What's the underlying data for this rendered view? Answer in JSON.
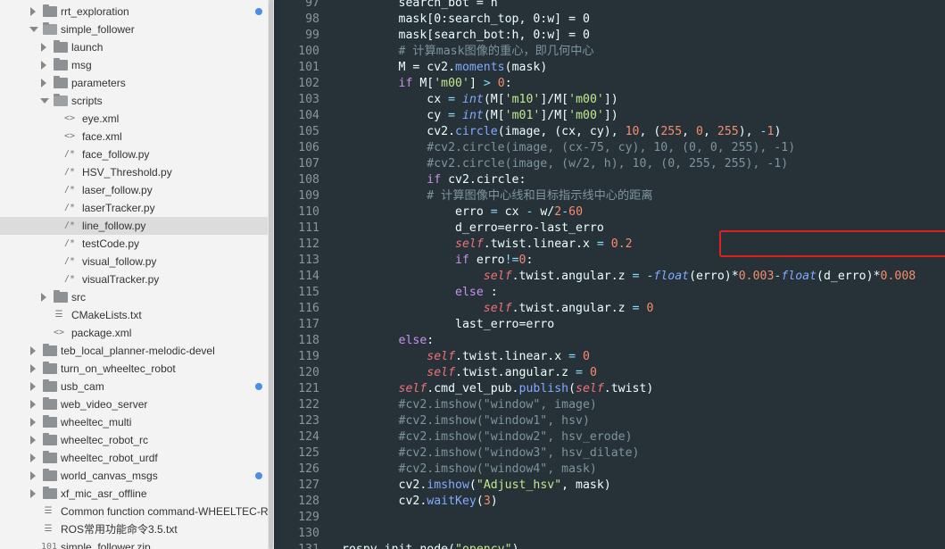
{
  "sidebar": {
    "items": [
      {
        "label": "rrt_exploration",
        "type": "folder",
        "level": 0,
        "expanded": false,
        "dot": true
      },
      {
        "label": "simple_follower",
        "type": "folder",
        "level": 0,
        "expanded": true,
        "dot": false
      },
      {
        "label": "launch",
        "type": "folder",
        "level": 1,
        "expanded": false,
        "dot": false
      },
      {
        "label": "msg",
        "type": "folder",
        "level": 1,
        "expanded": false,
        "dot": false
      },
      {
        "label": "parameters",
        "type": "folder",
        "level": 1,
        "expanded": false,
        "dot": false
      },
      {
        "label": "scripts",
        "type": "folder",
        "level": 1,
        "expanded": true,
        "dot": false
      },
      {
        "label": "eye.xml",
        "type": "file",
        "icon": "<>",
        "level": 2
      },
      {
        "label": "face.xml",
        "type": "file",
        "icon": "<>",
        "level": 2
      },
      {
        "label": "face_follow.py",
        "type": "file",
        "icon": "/*",
        "level": 2
      },
      {
        "label": "HSV_Threshold.py",
        "type": "file",
        "icon": "/*",
        "level": 2
      },
      {
        "label": "laser_follow.py",
        "type": "file",
        "icon": "/*",
        "level": 2
      },
      {
        "label": "laserTracker.py",
        "type": "file",
        "icon": "/*",
        "level": 2
      },
      {
        "label": "line_follow.py",
        "type": "file",
        "icon": "/*",
        "level": 2,
        "selected": true
      },
      {
        "label": "testCode.py",
        "type": "file",
        "icon": "/*",
        "level": 2
      },
      {
        "label": "visual_follow.py",
        "type": "file",
        "icon": "/*",
        "level": 2
      },
      {
        "label": "visualTracker.py",
        "type": "file",
        "icon": "/*",
        "level": 2
      },
      {
        "label": "src",
        "type": "folder",
        "level": 1,
        "expanded": false,
        "dot": false
      },
      {
        "label": "CMakeLists.txt",
        "type": "file",
        "icon": "☰",
        "level": 1
      },
      {
        "label": "package.xml",
        "type": "file",
        "icon": "<>",
        "level": 1
      },
      {
        "label": "teb_local_planner-melodic-devel",
        "type": "folder",
        "level": 0,
        "expanded": false,
        "dot": false
      },
      {
        "label": "turn_on_wheeltec_robot",
        "type": "folder",
        "level": 0,
        "expanded": false,
        "dot": false
      },
      {
        "label": "usb_cam",
        "type": "folder",
        "level": 0,
        "expanded": false,
        "dot": true
      },
      {
        "label": "web_video_server",
        "type": "folder",
        "level": 0,
        "expanded": false,
        "dot": false
      },
      {
        "label": "wheeltec_multi",
        "type": "folder",
        "level": 0,
        "expanded": false,
        "dot": false
      },
      {
        "label": "wheeltec_robot_rc",
        "type": "folder",
        "level": 0,
        "expanded": false,
        "dot": false
      },
      {
        "label": "wheeltec_robot_urdf",
        "type": "folder",
        "level": 0,
        "expanded": false,
        "dot": false
      },
      {
        "label": "world_canvas_msgs",
        "type": "folder",
        "level": 0,
        "expanded": false,
        "dot": true
      },
      {
        "label": "xf_mic_asr_offline",
        "type": "folder",
        "level": 0,
        "expanded": false,
        "dot": false
      },
      {
        "label": "Common function command-WHEELTEC-RC",
        "type": "file",
        "icon": "☰",
        "level": 0
      },
      {
        "label": "ROS常用功能命令3.5.txt",
        "type": "file",
        "icon": "☰",
        "level": 0
      },
      {
        "label": "simple_follower.zip",
        "type": "file",
        "icon": "101",
        "level": 0
      }
    ]
  },
  "editor": {
    "file": "line_follow.py",
    "lines": [
      {
        "n": "97",
        "t": [
          [
            "id",
            "        search_bot = h"
          ]
        ]
      },
      {
        "n": "98",
        "t": [
          [
            "id",
            "        mask[0:search_top, 0:w] = 0"
          ]
        ]
      },
      {
        "n": "99",
        "t": [
          [
            "id",
            "        mask[search_bot:h, 0:w] = 0"
          ]
        ]
      },
      {
        "n": "100",
        "t": [
          [
            "cm",
            "        # 计算mask图像的重心，即几何中心"
          ]
        ]
      },
      {
        "n": "101",
        "t": [
          [
            "id",
            "        M = cv2."
          ],
          [
            "fn",
            "moments"
          ],
          [
            "id",
            "(mask)"
          ]
        ]
      },
      {
        "n": "102",
        "t": [
          [
            "kw",
            "        if "
          ],
          [
            "id",
            "M["
          ],
          [
            "str",
            "'m00'"
          ],
          [
            "id",
            "] "
          ],
          [
            "op",
            ">"
          ],
          [
            "id",
            " "
          ],
          [
            "num",
            "0"
          ],
          [
            "id",
            ":"
          ]
        ]
      },
      {
        "n": "103",
        "t": [
          [
            "id",
            "            cx "
          ],
          [
            "op",
            "="
          ],
          [
            "id",
            " "
          ],
          [
            "bi",
            "int"
          ],
          [
            "id",
            "(M["
          ],
          [
            "str",
            "'m10'"
          ],
          [
            "id",
            "]/M["
          ],
          [
            "str",
            "'m00'"
          ],
          [
            "id",
            "])"
          ]
        ]
      },
      {
        "n": "104",
        "t": [
          [
            "id",
            "            cy "
          ],
          [
            "op",
            "="
          ],
          [
            "id",
            " "
          ],
          [
            "bi",
            "int"
          ],
          [
            "id",
            "(M["
          ],
          [
            "str",
            "'m01'"
          ],
          [
            "id",
            "]/M["
          ],
          [
            "str",
            "'m00'"
          ],
          [
            "id",
            "])"
          ]
        ]
      },
      {
        "n": "105",
        "t": [
          [
            "id",
            "            cv2."
          ],
          [
            "fn",
            "circle"
          ],
          [
            "id",
            "(image, (cx, cy), "
          ],
          [
            "num",
            "10"
          ],
          [
            "id",
            ", ("
          ],
          [
            "num",
            "255"
          ],
          [
            "id",
            ", "
          ],
          [
            "num",
            "0"
          ],
          [
            "id",
            ", "
          ],
          [
            "num",
            "255"
          ],
          [
            "id",
            "), "
          ],
          [
            "op",
            "-"
          ],
          [
            "num",
            "1"
          ],
          [
            "id",
            ")"
          ]
        ]
      },
      {
        "n": "106",
        "t": [
          [
            "cm",
            "            #cv2.circle(image, (cx-75, cy), 10, (0, 0, 255), -1)"
          ]
        ]
      },
      {
        "n": "107",
        "t": [
          [
            "cm",
            "            #cv2.circle(image, (w/2, h), 10, (0, 255, 255), -1)"
          ]
        ]
      },
      {
        "n": "108",
        "t": [
          [
            "kw",
            "            if "
          ],
          [
            "id",
            "cv2.circle:"
          ]
        ]
      },
      {
        "n": "109",
        "t": [
          [
            "cm",
            "            # 计算图像中心线和目标指示线中心的距离"
          ]
        ]
      },
      {
        "n": "110",
        "t": [
          [
            "id",
            "                erro "
          ],
          [
            "op",
            "="
          ],
          [
            "id",
            " cx "
          ],
          [
            "op",
            "-"
          ],
          [
            "id",
            " w/"
          ],
          [
            "num",
            "2"
          ],
          [
            "op",
            "-"
          ],
          [
            "num",
            "60"
          ]
        ]
      },
      {
        "n": "111",
        "t": [
          [
            "id",
            "                d_erro=erro-last_erro"
          ]
        ]
      },
      {
        "n": "112",
        "t": [
          [
            "self",
            "                self"
          ],
          [
            "id",
            ".twist.linear.x "
          ],
          [
            "op",
            "="
          ],
          [
            "id",
            " "
          ],
          [
            "num",
            "0.2"
          ]
        ]
      },
      {
        "n": "113",
        "t": [
          [
            "kw",
            "                if "
          ],
          [
            "id",
            "erro"
          ],
          [
            "op",
            "!="
          ],
          [
            "num",
            "0"
          ],
          [
            "id",
            ":"
          ]
        ]
      },
      {
        "n": "114",
        "t": [
          [
            "self",
            "                    self"
          ],
          [
            "id",
            ".twist.angular.z "
          ],
          [
            "op",
            "="
          ],
          [
            "id",
            " "
          ],
          [
            "op",
            "-"
          ],
          [
            "bi",
            "float"
          ],
          [
            "id",
            "(erro)*"
          ],
          [
            "num",
            "0.003"
          ],
          [
            "op",
            "-"
          ],
          [
            "bi",
            "float"
          ],
          [
            "id",
            "(d_erro)*"
          ],
          [
            "num",
            "0.008"
          ]
        ]
      },
      {
        "n": "115",
        "t": [
          [
            "kw",
            "                else "
          ],
          [
            "id",
            ":"
          ]
        ]
      },
      {
        "n": "116",
        "t": [
          [
            "self",
            "                    self"
          ],
          [
            "id",
            ".twist.angular.z "
          ],
          [
            "op",
            "="
          ],
          [
            "id",
            " "
          ],
          [
            "num",
            "0"
          ]
        ]
      },
      {
        "n": "117",
        "t": [
          [
            "id",
            "                last_erro=erro"
          ]
        ]
      },
      {
        "n": "118",
        "t": [
          [
            "kw",
            "        else"
          ],
          [
            "id",
            ":"
          ]
        ]
      },
      {
        "n": "119",
        "t": [
          [
            "self",
            "            self"
          ],
          [
            "id",
            ".twist.linear.x "
          ],
          [
            "op",
            "="
          ],
          [
            "id",
            " "
          ],
          [
            "num",
            "0"
          ]
        ]
      },
      {
        "n": "120",
        "t": [
          [
            "self",
            "            self"
          ],
          [
            "id",
            ".twist.angular.z "
          ],
          [
            "op",
            "="
          ],
          [
            "id",
            " "
          ],
          [
            "num",
            "0"
          ]
        ]
      },
      {
        "n": "121",
        "t": [
          [
            "self",
            "        self"
          ],
          [
            "id",
            ".cmd_vel_pub."
          ],
          [
            "fn",
            "publish"
          ],
          [
            "id",
            "("
          ],
          [
            "self",
            "self"
          ],
          [
            "id",
            ".twist)"
          ]
        ]
      },
      {
        "n": "122",
        "t": [
          [
            "cm",
            "        #cv2.imshow(\"window\", image)"
          ]
        ]
      },
      {
        "n": "123",
        "t": [
          [
            "cm",
            "        #cv2.imshow(\"window1\", hsv)"
          ]
        ]
      },
      {
        "n": "124",
        "t": [
          [
            "cm",
            "        #cv2.imshow(\"window2\", hsv_erode)"
          ]
        ]
      },
      {
        "n": "125",
        "t": [
          [
            "cm",
            "        #cv2.imshow(\"window3\", hsv_dilate)"
          ]
        ]
      },
      {
        "n": "126",
        "t": [
          [
            "cm",
            "        #cv2.imshow(\"window4\", mask)"
          ]
        ]
      },
      {
        "n": "127",
        "t": [
          [
            "id",
            "        cv2."
          ],
          [
            "fn",
            "imshow"
          ],
          [
            "id",
            "("
          ],
          [
            "str",
            "\"Adjust_hsv\""
          ],
          [
            "id",
            ", mask)"
          ]
        ]
      },
      {
        "n": "128",
        "t": [
          [
            "id",
            "        cv2."
          ],
          [
            "fn",
            "waitKey"
          ],
          [
            "id",
            "("
          ],
          [
            "num",
            "3"
          ],
          [
            "id",
            ")"
          ]
        ]
      },
      {
        "n": "129",
        "t": []
      },
      {
        "n": "130",
        "t": []
      },
      {
        "n": "131",
        "t": [
          [
            "id",
            "rospy.init_node("
          ],
          [
            "str",
            "\"opencv\""
          ],
          [
            "id",
            ")"
          ]
        ]
      }
    ]
  }
}
